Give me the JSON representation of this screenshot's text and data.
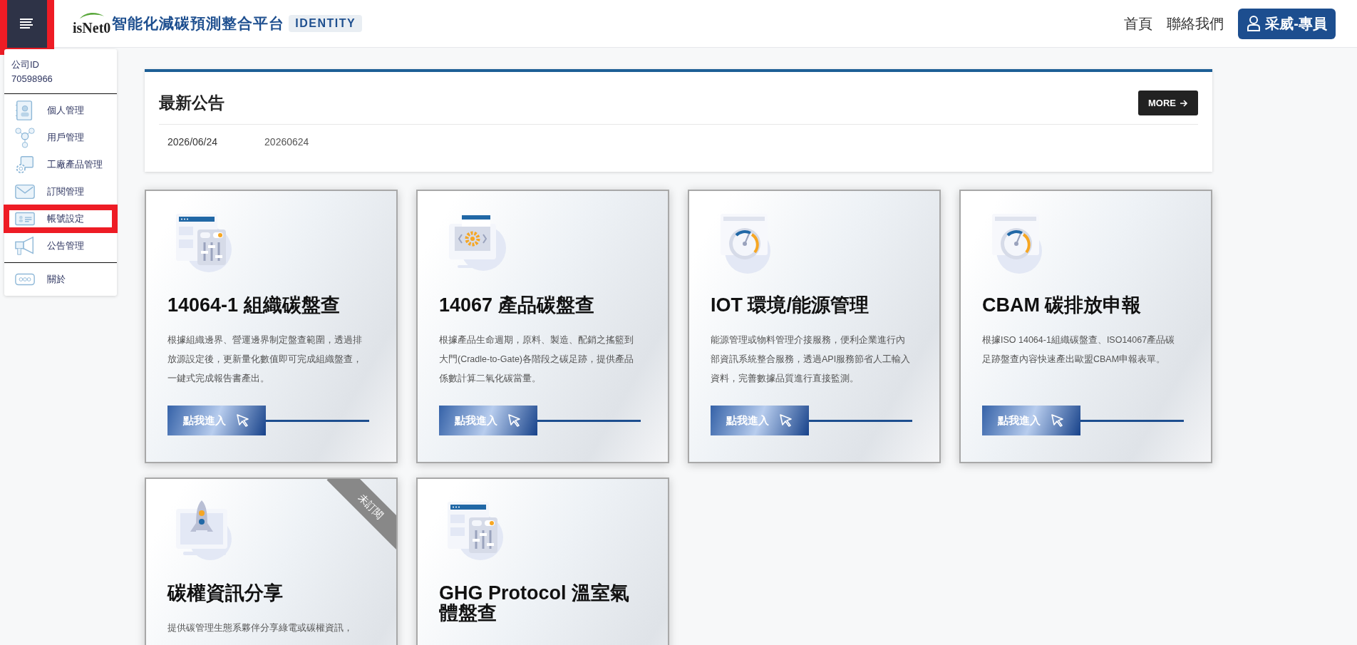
{
  "header": {
    "menu_button": {
      "highlighted": true
    },
    "logo_text": "isNet0",
    "title": "智能化減碳預測整合平台",
    "badge": "IDENTITY",
    "nav": [
      "首頁",
      "聯絡我們"
    ],
    "user_button": "采威-專員"
  },
  "sidebar": {
    "company_label": "公司ID",
    "company_id": "70598966",
    "sections": [
      {
        "items": [
          {
            "label": "個人管理",
            "kind": "contact",
            "highlighted": false
          },
          {
            "label": "用戶管理",
            "kind": "network",
            "highlighted": false
          },
          {
            "label": "工廠產品管理",
            "kind": "factory",
            "highlighted": false
          },
          {
            "label": "訂閱管理",
            "kind": "mail",
            "highlighted": false
          },
          {
            "label": "帳號設定",
            "kind": "account",
            "highlighted": true
          },
          {
            "label": "公告管理",
            "kind": "announce",
            "highlighted": false
          }
        ]
      },
      {
        "items": [
          {
            "label": "關於",
            "kind": "about",
            "highlighted": false
          }
        ]
      }
    ]
  },
  "notice": {
    "title": "最新公告",
    "more": "MORE",
    "rows": [
      {
        "date": "2026/06/24",
        "title": "20260624"
      }
    ]
  },
  "cards": [
    {
      "kind": "organization",
      "title": "14064-1 組織碳盤查",
      "description": "根據組織邊界、營運邊界制定盤查範圍，透過排放源設定後，更新量化數值即可完成組織盤查，一鍵式完成報告書產出。",
      "button": "點我進入"
    },
    {
      "kind": "product",
      "title": "14067 產品碳盤查",
      "description": "根據產品生命週期，原料、製造、配銷之搖籃到大門(Cradle-to-Gate)各階段之碳足跡，提供產品係數計算二氧化碳當量。",
      "button": "點我進入"
    },
    {
      "kind": "iot",
      "title": "IOT 環境/能源管理",
      "description": "能源管理或物料管理介接服務，便利企業進行內部資訊系統整合服務，透過API服務節省人工輸入資料，完善數據品質進行直接監測。",
      "button": "點我進入"
    },
    {
      "kind": "cbam",
      "title": "CBAM 碳排放申報",
      "description": "根據ISO 14064-1組織碳盤查、ISO14067產品碳足跡盤查內容快速產出歐盟CBAM申報表單。",
      "button": "點我進入"
    },
    {
      "kind": "credits",
      "title": "碳權資訊分享",
      "description": "提供碳管理生態系夥伴分享綠電或碳權資訊，",
      "ribbon": "未訂閱"
    },
    {
      "kind": "ghg",
      "title": "GHG Protocol 溫室氣體盤查"
    }
  ]
}
